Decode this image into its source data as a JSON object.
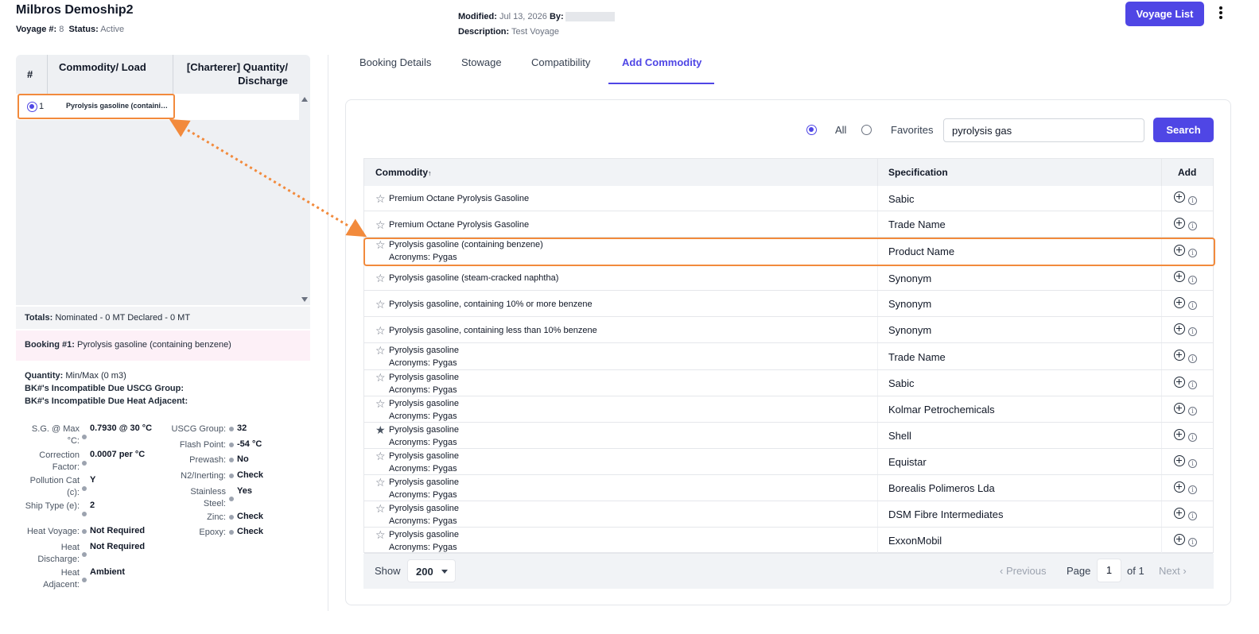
{
  "header": {
    "title": "Milbros Demoship2",
    "voyage_label": "Voyage #:",
    "voyage_value": "8",
    "status_label": "Status:",
    "status_value": "Active",
    "modified_label": "Modified:",
    "modified_value": "Jul 13, 2026",
    "by_label": "By:",
    "description_label": "Description:",
    "description_value": "Test Voyage",
    "voyage_list_button": "Voyage List"
  },
  "left": {
    "col_num": "#",
    "col_commodity": "Commodity/ Load",
    "col_quantity": "[Charterer] Quantity/ Discharge",
    "rows": [
      {
        "num": "1",
        "name": "Pyrolysis gasoline (containing benzene)"
      }
    ],
    "totals_label": "Totals:",
    "totals_value": "Nominated - 0 MT Declared - 0 MT",
    "booking_label": "Booking #1:",
    "booking_value": "Pyrolysis gasoline (containing benzene)",
    "quantity_label": "Quantity:",
    "quantity_value": "Min/Max (0 m3)",
    "incompat_uscg": "BK#'s Incompatible Due USCG Group:",
    "incompat_heat": "BK#'s Incompatible Due Heat Adjacent:",
    "props_left": [
      {
        "label": "S.G. @ Max °C:",
        "value": "0.7930 @ 30 °C"
      },
      {
        "label": "Correction Factor:",
        "value": "0.0007 per °C"
      },
      {
        "label": "Pollution Cat (c):",
        "value": "Y"
      },
      {
        "label": "Ship Type (e):",
        "value": "2"
      },
      {
        "label": "Heat Voyage:",
        "value": "Not Required"
      },
      {
        "label": "Heat Discharge:",
        "value": "Not Required"
      },
      {
        "label": "Heat Adjacent:",
        "value": "Ambient"
      }
    ],
    "props_right": [
      {
        "label": "USCG Group:",
        "value": "32"
      },
      {
        "label": "Flash Point:",
        "value": "-54 °C"
      },
      {
        "label": "Prewash:",
        "value": "No"
      },
      {
        "label": "N2/Inerting:",
        "value": "Check"
      },
      {
        "label": "Stainless Steel:",
        "value": "Yes"
      },
      {
        "label": "Zinc:",
        "value": "Check"
      },
      {
        "label": "Epoxy:",
        "value": "Check"
      }
    ]
  },
  "tabs": [
    "Booking Details",
    "Stowage",
    "Compatibility",
    "Add Commodity"
  ],
  "search": {
    "filter_all": "All",
    "filter_favorites": "Favorites",
    "query": "pyrolysis gas",
    "button": "Search"
  },
  "table": {
    "col_commodity": "Commodity",
    "sort_indicator": "↑",
    "col_specification": "Specification",
    "col_add": "Add",
    "rows": [
      {
        "name": "Premium Octane Pyrolysis Gasoline",
        "acronym": "",
        "spec": "Sabic",
        "favorite": false
      },
      {
        "name": "Premium Octane Pyrolysis Gasoline",
        "acronym": "",
        "spec": "Trade Name",
        "favorite": false
      },
      {
        "name": "Pyrolysis gasoline (containing benzene)",
        "acronym": "Acronyms: Pygas",
        "spec": "Product Name",
        "favorite": false
      },
      {
        "name": "Pyrolysis gasoline (steam-cracked naphtha)",
        "acronym": "",
        "spec": "Synonym",
        "favorite": false
      },
      {
        "name": "Pyrolysis gasoline, containing 10% or more benzene",
        "acronym": "",
        "spec": "Synonym",
        "favorite": false
      },
      {
        "name": "Pyrolysis gasoline, containing less than 10% benzene",
        "acronym": "",
        "spec": "Synonym",
        "favorite": false
      },
      {
        "name": "Pyrolysis gasoline",
        "acronym": "Acronyms: Pygas",
        "spec": "Trade Name",
        "favorite": false
      },
      {
        "name": "Pyrolysis gasoline",
        "acronym": "Acronyms: Pygas",
        "spec": "Sabic",
        "favorite": false
      },
      {
        "name": "Pyrolysis gasoline",
        "acronym": "Acronyms: Pygas",
        "spec": "Kolmar Petrochemicals",
        "favorite": false
      },
      {
        "name": "Pyrolysis gasoline",
        "acronym": "Acronyms: Pygas",
        "spec": "Shell",
        "favorite": true
      },
      {
        "name": "Pyrolysis gasoline",
        "acronym": "Acronyms: Pygas",
        "spec": "Equistar",
        "favorite": false
      },
      {
        "name": "Pyrolysis gasoline",
        "acronym": "Acronyms: Pygas",
        "spec": "Borealis Polimeros Lda",
        "favorite": false
      },
      {
        "name": "Pyrolysis gasoline",
        "acronym": "Acronyms: Pygas",
        "spec": "DSM Fibre Intermediates",
        "favorite": false
      },
      {
        "name": "Pyrolysis gasoline",
        "acronym": "Acronyms: Pygas",
        "spec": "ExxonMobil",
        "favorite": false
      }
    ]
  },
  "footer": {
    "show_label": "Show",
    "show_value": "200",
    "previous": "‹ Previous",
    "page_label": "Page",
    "page_value": "1",
    "of_label": "of 1",
    "next": "Next ›"
  },
  "colors": {
    "accent": "#4f46e5",
    "highlight": "#f28a3c"
  }
}
